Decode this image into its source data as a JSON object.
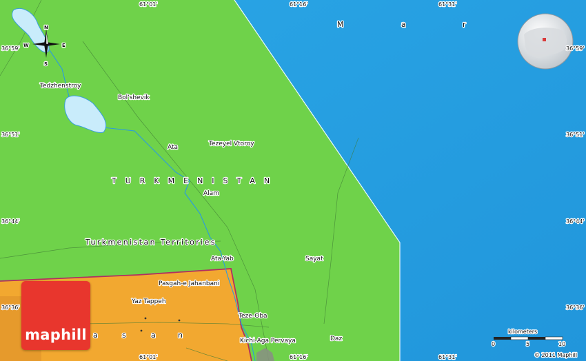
{
  "map": {
    "country_label": "TURKMENISTAN",
    "territory_label": "Turkmenistan Territories",
    "sea_letters": [
      "M",
      "a",
      "r"
    ],
    "province_letters": [
      "a",
      "s",
      "a",
      "n"
    ],
    "towns": {
      "tedzhenstroy": "Tedzhenstroy",
      "bolshevik": "Bol'shevik",
      "ata": "Ata",
      "tezeyel": "Tezeyel Vtoroy",
      "alam": "Alam",
      "atayab": "Ata-Yab",
      "sayat": "Sayat",
      "pasgah": "Pasgah-e Jahanbani",
      "yaztappeh": "Yaz Tappeh",
      "tezeoba": "Teze-Oba",
      "kichiaga": "Kichi-Aga Pervaya",
      "daz": "Daz"
    },
    "coords": {
      "top_0101": "61°01'",
      "top_6116": "61°16'",
      "top_6131": "61°31'",
      "bottom_0101": "61°01'",
      "bottom_6116": "61°16'",
      "bottom_6131": "61°31'",
      "left_3659": "36°59'",
      "left_3651": "36°51'",
      "left_3644": "36°44'",
      "left_3636": "36°36'",
      "right_3659": "36°59'",
      "right_3651": "36°51'",
      "right_3644": "36°44'",
      "right_3636": "36°36'"
    },
    "compass": {
      "n": "N",
      "s": "S",
      "e": "E",
      "w": "W"
    },
    "colors": {
      "land": "#6fd24a",
      "sea": "#29a3e3",
      "neighbor": "#f2a830",
      "border": "#b03060",
      "water": "#c9ecfb"
    }
  },
  "scale": {
    "title": "kilometers",
    "ticks": [
      "0",
      "5",
      "10"
    ]
  },
  "logo": {
    "text": "maphill"
  },
  "copyright": "© 2011 Maphill"
}
